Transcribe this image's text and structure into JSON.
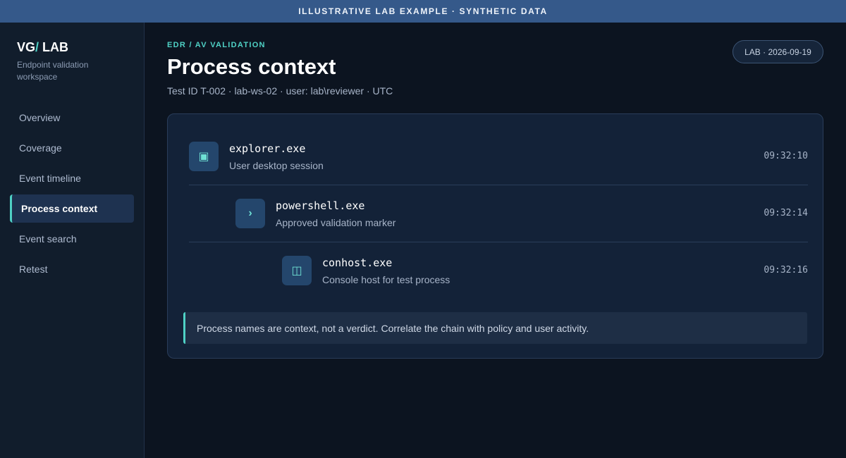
{
  "banner": {
    "text": "ILLUSTRATIVE LAB EXAMPLE · SYNTHETIC DATA"
  },
  "brand": {
    "part1": "VG",
    "slash": "/",
    "part2": " LAB",
    "subtitle": "Endpoint validation workspace"
  },
  "nav": [
    {
      "label": "Overview",
      "active": false
    },
    {
      "label": "Coverage",
      "active": false
    },
    {
      "label": "Event timeline",
      "active": false
    },
    {
      "label": "Process context",
      "active": true
    },
    {
      "label": "Event search",
      "active": false
    },
    {
      "label": "Retest",
      "active": false
    }
  ],
  "header": {
    "eyebrow": "EDR / AV VALIDATION",
    "title": "Process context",
    "meta": "Test ID T-002 · lab-ws-02 · user: lab\\reviewer · UTC",
    "badge": "LAB · 2026-09-19"
  },
  "processes": [
    {
      "icon": "window-icon",
      "glyph": "▣",
      "name": "explorer.exe",
      "desc": "User desktop session",
      "time": "09:32:10"
    },
    {
      "icon": "prompt-icon",
      "glyph": "›",
      "name": "powershell.exe",
      "desc": "Approved validation marker",
      "time": "09:32:14"
    },
    {
      "icon": "console-icon",
      "glyph": "◫",
      "name": "conhost.exe",
      "desc": "Console host for test process",
      "time": "09:32:16"
    }
  ],
  "note": {
    "text": "Process names are context, not a verdict. Correlate the chain with policy and user activity."
  },
  "colors": {
    "accent": "#4fd1c5",
    "banner": "#35598a",
    "background": "#0c1420",
    "card": "#132238"
  }
}
